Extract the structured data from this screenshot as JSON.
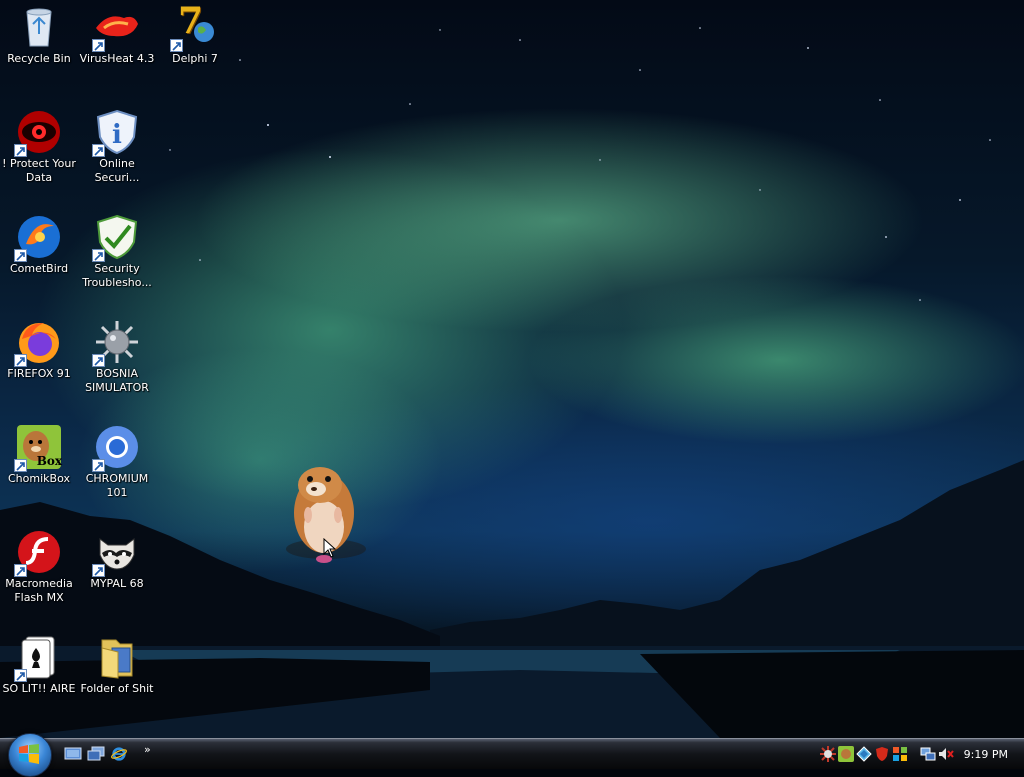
{
  "desktop": {
    "icons": [
      {
        "label": "Recycle Bin",
        "icon": "recycle-bin-icon"
      },
      {
        "label": "VirusHeat 4.3",
        "icon": "virusheat-icon"
      },
      {
        "label": "Delphi 7",
        "icon": "delphi-icon"
      },
      {
        "label": "! Protect Your Data",
        "icon": "red-eye-icon"
      },
      {
        "label": "Online Securi...",
        "icon": "online-security-icon"
      },
      {
        "label": "CometBird",
        "icon": "cometbird-icon"
      },
      {
        "label": "Security Troublesho...",
        "icon": "security-shield-icon"
      },
      {
        "label": "FIREFOX 91",
        "icon": "firefox-icon"
      },
      {
        "label": "BOSNIA SIMULATOR",
        "icon": "spiked-mine-icon"
      },
      {
        "label": "ChomikBox",
        "icon": "chomikbox-icon"
      },
      {
        "label": "CHROMIUM 101",
        "icon": "chromium-icon"
      },
      {
        "label": "Macromedia Flash MX",
        "icon": "flash-icon"
      },
      {
        "label": "MYPAL 68",
        "icon": "raccoon-icon"
      },
      {
        "label": "SO LIT!! AIRE",
        "icon": "solitaire-icon"
      },
      {
        "label": "Folder of Shit",
        "icon": "folder-icon"
      }
    ],
    "chomikbox_badge": "Box",
    "delphi_badge": "7"
  },
  "taskbar": {
    "more_label": "»",
    "clock": "9:19 PM"
  },
  "colors": {
    "aurora": "#62d89a",
    "taskbar": "#121419",
    "start_orb": "#3a86d6"
  }
}
